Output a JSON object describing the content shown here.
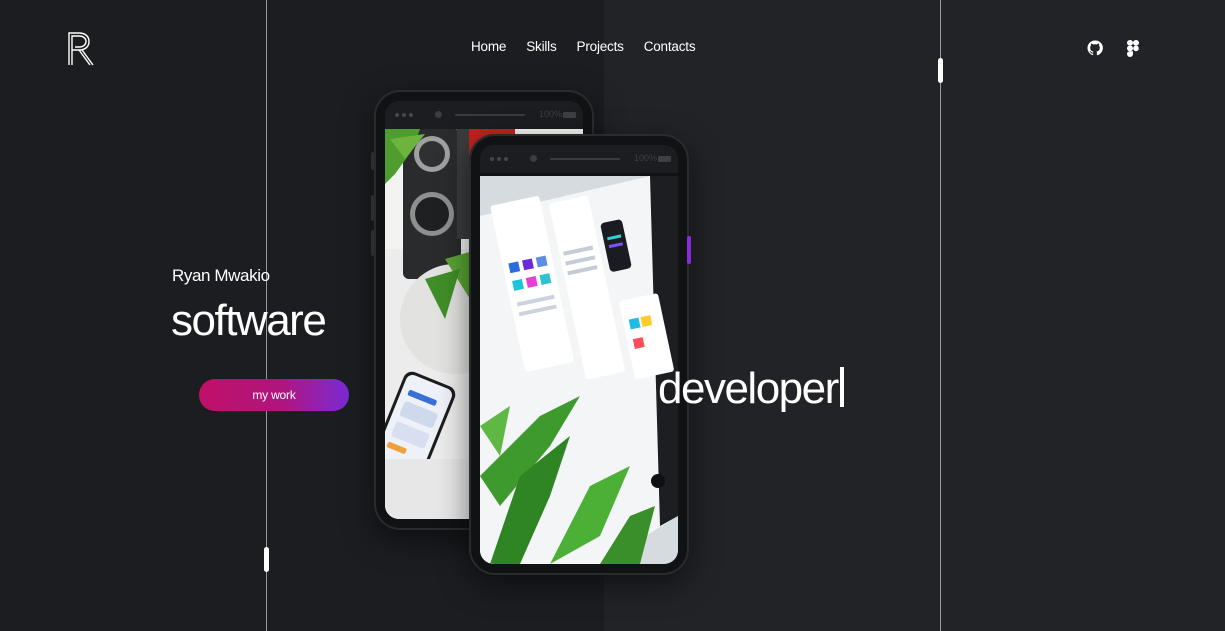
{
  "header": {
    "logo_icon": "r-monogram-logo",
    "nav": [
      {
        "label": "Home"
      },
      {
        "label": "Skills"
      },
      {
        "label": "Projects"
      },
      {
        "label": "Contacts"
      }
    ],
    "social": [
      {
        "icon": "github-icon"
      },
      {
        "icon": "figma-icon"
      }
    ]
  },
  "hero": {
    "name": "Ryan Mwakio",
    "word1": "software",
    "word2": "developer",
    "cta_label": "my work"
  },
  "phones": [
    {
      "status_percent": "100%"
    },
    {
      "status_percent": "100%"
    }
  ],
  "colors": {
    "background_left": "#1c1d21",
    "background_right": "#222327",
    "accent_start": "#c0106a",
    "accent_end": "#7a2bd6",
    "accent_bar": "#8a2cd9"
  }
}
